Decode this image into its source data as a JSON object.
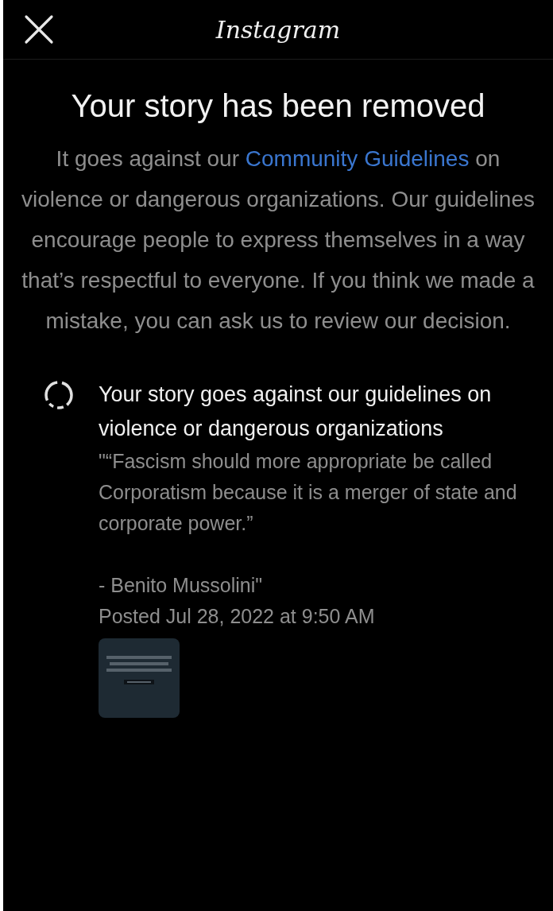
{
  "header": {
    "logo": "Instagram"
  },
  "title": "Your story has been removed",
  "message": {
    "before": "It goes against our ",
    "link": "Community Guidelines",
    "after": " on violence or dangerous organizations. Our guidelines encourage people to express themselves in a way that’s respectful to everyone. If you think we made a mistake, you can ask us to review our decision."
  },
  "violation": {
    "heading": "Your story goes against our guidelines on violence or dangerous organizations",
    "quote": "\"“Fascism should more appropriate be called Corporatism because it is a merger of state and corporate power.”",
    "attribution": "- Benito Mussolini\"",
    "posted": "Posted Jul 28, 2022 at 9:50 AM"
  }
}
